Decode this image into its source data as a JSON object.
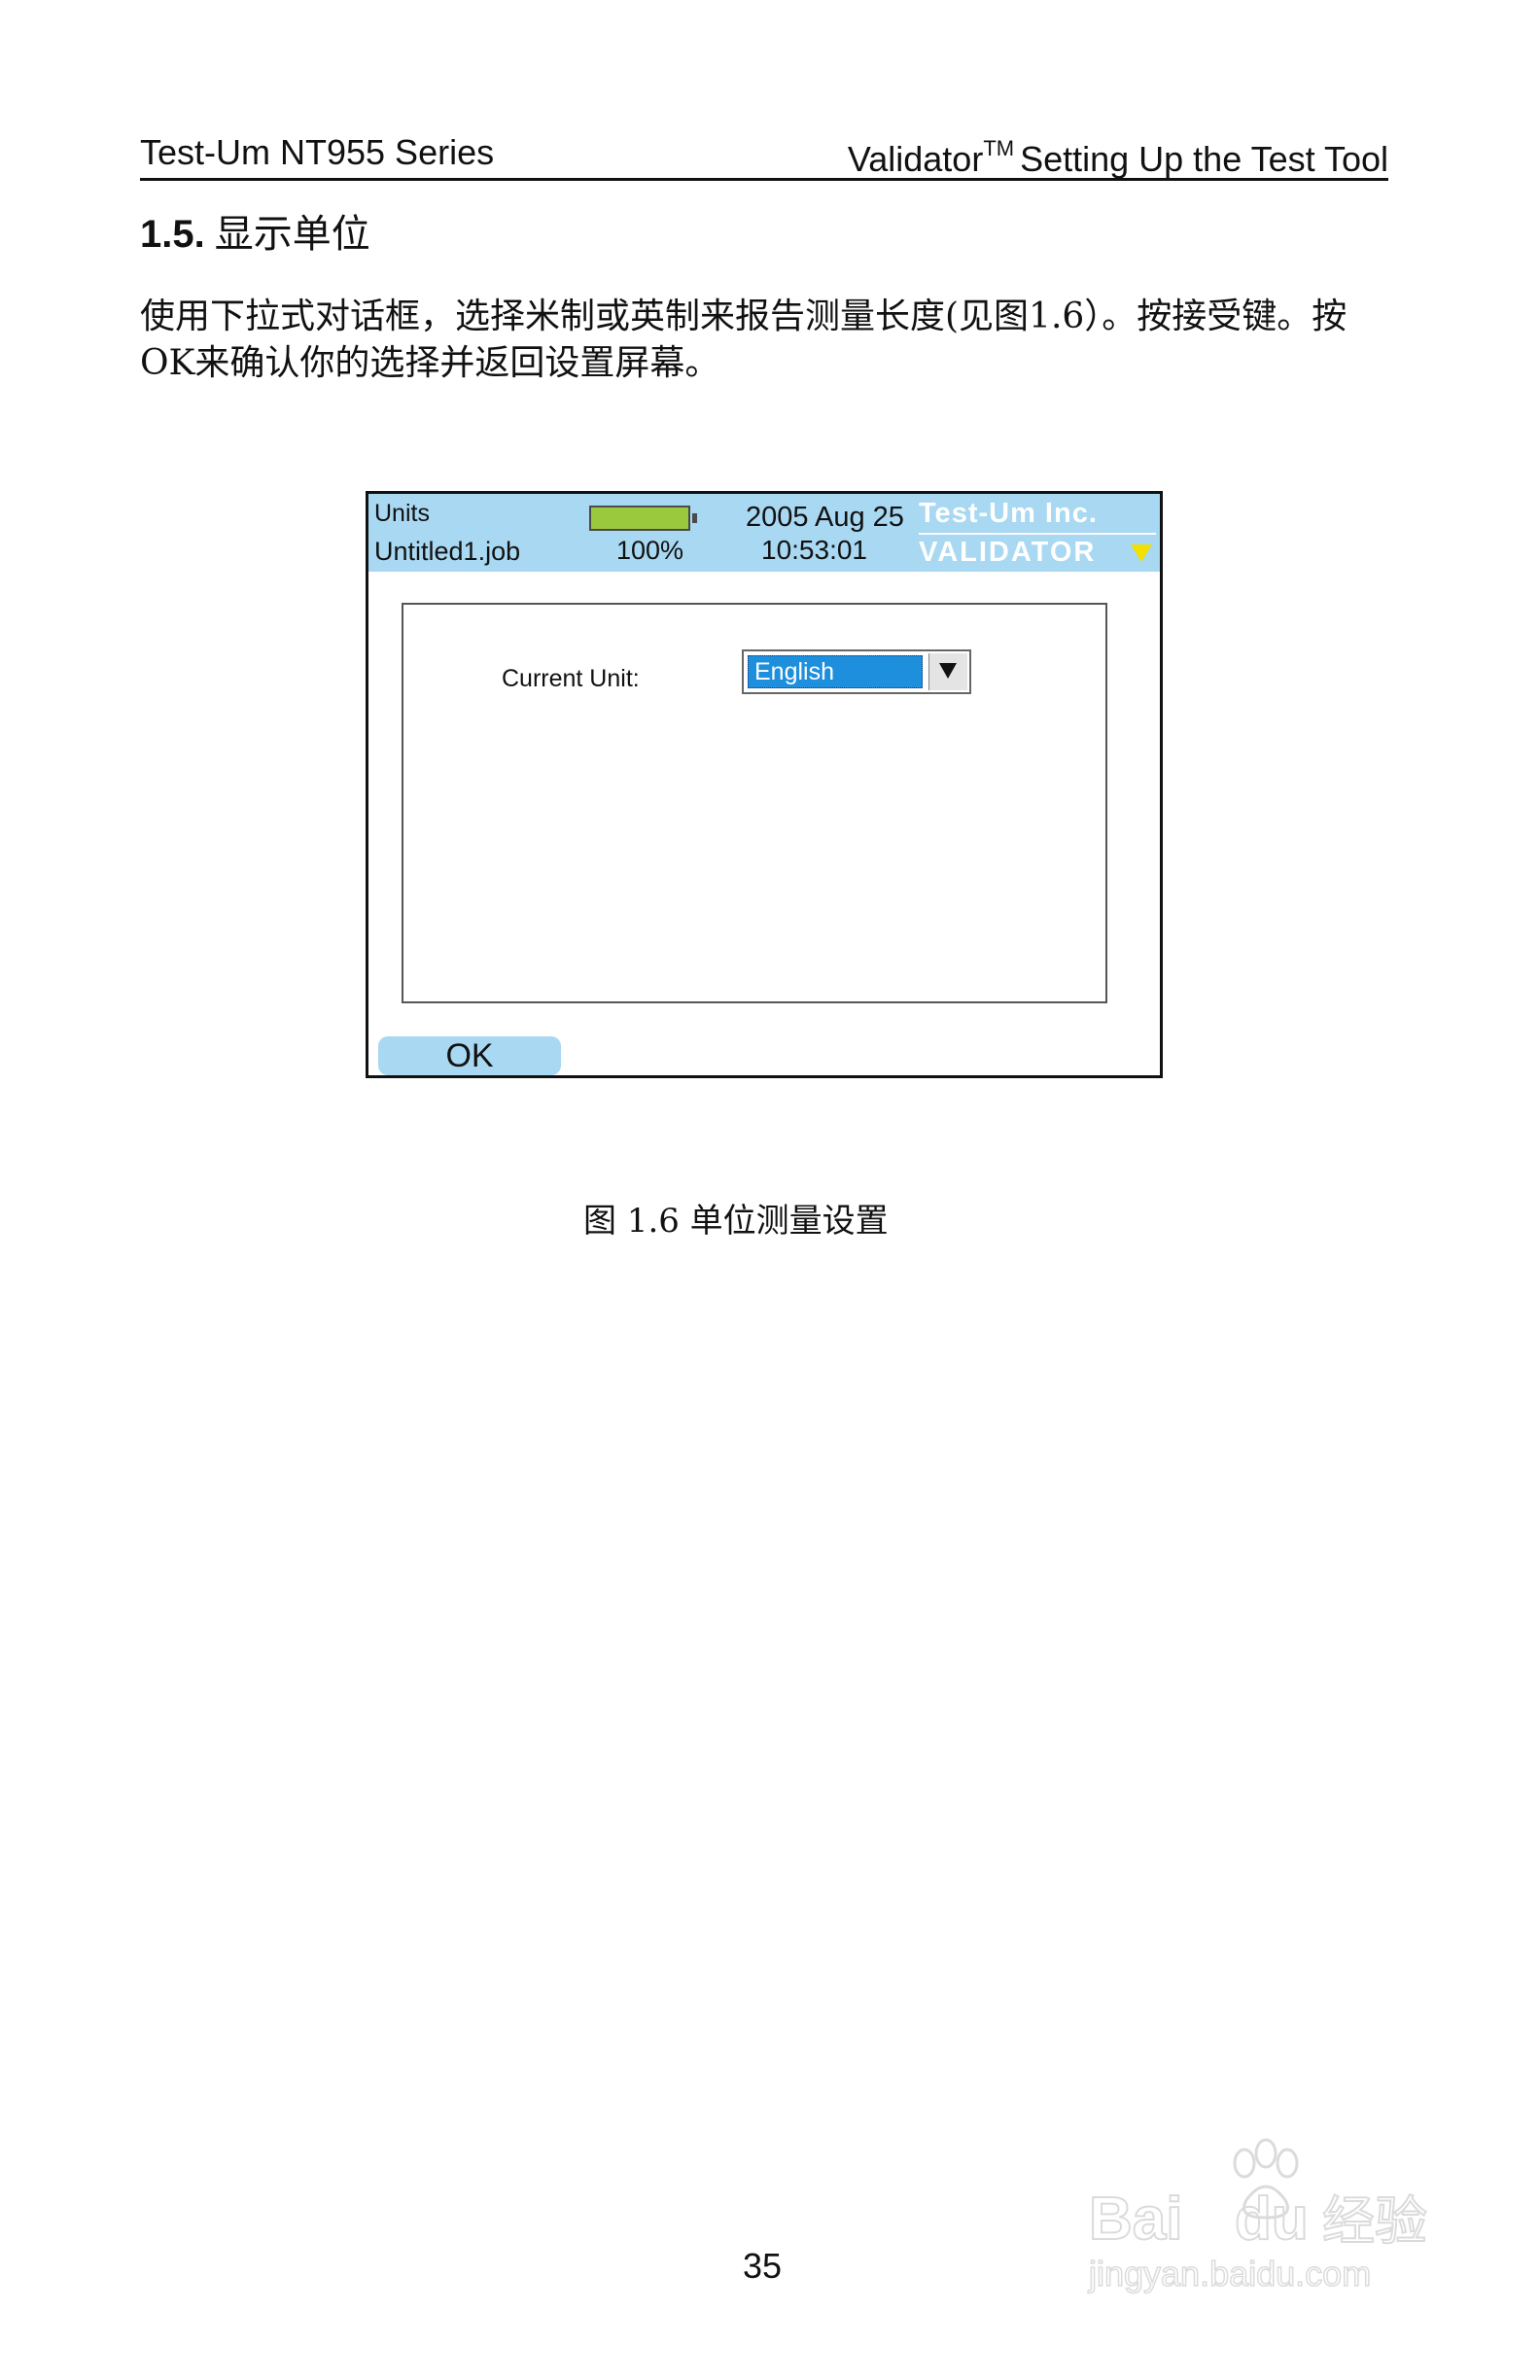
{
  "header": {
    "left": "Test-Um NT955 Series",
    "right_brand": "Validator",
    "right_tm": "TM",
    "right_title": "Setting Up the Test Tool"
  },
  "section": {
    "number": "1.5.",
    "title": "显示单位"
  },
  "paragraph": "使用下拉式对话框，选择米制或英制来报告测量长度(见图1.6）。按接受键。按OK来确认你的选择并返回设置屏幕。",
  "device": {
    "screen_name": "Units",
    "job_file": "Untitled1.job",
    "battery_percent_label": "100%",
    "battery_level": 1.0,
    "date": "2005 Aug 25",
    "time": "10:53:01",
    "brand_line1": "Test-Um Inc.",
    "brand_line2": "VALIDATOR",
    "current_unit_label": "Current Unit:",
    "current_unit_value": "English",
    "ok_label": "OK",
    "colors": {
      "topbar": "#a8d8f2",
      "battery": "#9bc93d",
      "selection": "#1e8fdc",
      "brand_arrow": "#f2e000"
    }
  },
  "caption": "图 1.6 单位测量设置",
  "page_number": "35",
  "watermark": {
    "line1": "Bai du 经验",
    "line2": "jingyan.baidu.com"
  }
}
